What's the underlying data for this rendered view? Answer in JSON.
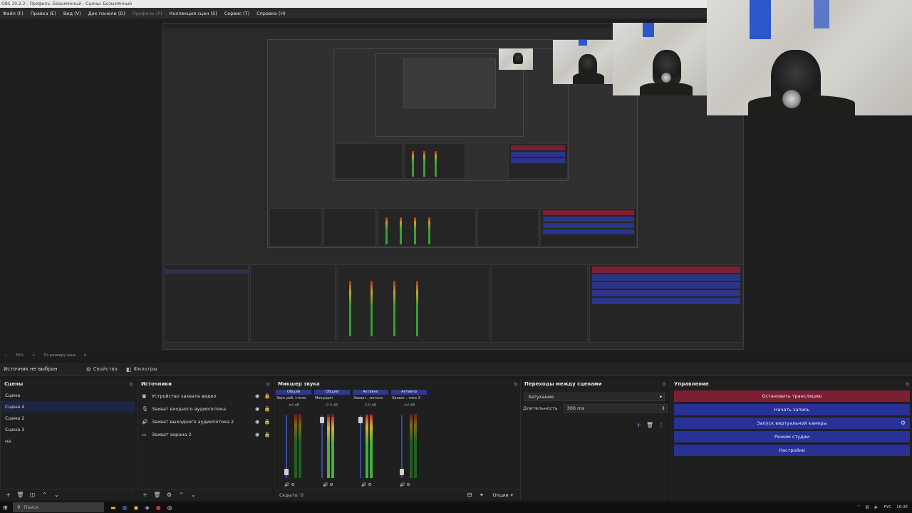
{
  "window": {
    "title": "OBS 30.2.2 - Профиль: Безымянный - Сцены: Безымянный"
  },
  "menu": [
    {
      "label": "Файл (F)",
      "enabled": true
    },
    {
      "label": "Правка (E)",
      "enabled": true
    },
    {
      "label": "Вид (V)",
      "enabled": true
    },
    {
      "label": "Док-панели (D)",
      "enabled": true
    },
    {
      "label": "Профиль (P)",
      "enabled": false
    },
    {
      "label": "Коллекция сцен (S)",
      "enabled": true
    },
    {
      "label": "Сервис (T)",
      "enabled": true
    },
    {
      "label": "Справка (H)",
      "enabled": true
    }
  ],
  "statusbar": {
    "zoom": "50%",
    "fit": "По размеру окна"
  },
  "context": {
    "no_source": "Источник не выбран",
    "properties": "Свойства",
    "filters": "Фильтры"
  },
  "scenes": {
    "title": "Сцены",
    "items": [
      "Сцена",
      "Сцена 4",
      "Сцена 2",
      "Сцена 3",
      "на"
    ],
    "selected_index": 1
  },
  "sources": {
    "title": "Источники",
    "items": [
      {
        "name": "Устройство захвата видео",
        "icon": "camera-icon"
      },
      {
        "name": "Захват входного аудиопотока",
        "icon": "microphone-icon"
      },
      {
        "name": "Захват выходного аудиопотока 2",
        "icon": "speaker-icon"
      },
      {
        "name": "Захват экрана 2",
        "icon": "monitor-icon"
      }
    ]
  },
  "mixer": {
    "title": "Микшер звука",
    "channels": [
      {
        "tab": "Общий",
        "name": "Звук раб. стола",
        "db": "-inf dB",
        "level": 0.0,
        "fader": 0.05
      },
      {
        "tab": "Общий",
        "name": "Микр/доп",
        "db": "0.0 dB",
        "level": 0.96,
        "fader": 0.96
      },
      {
        "tab": "Активно",
        "name": "Захват...потока",
        "db": "0.0 dB",
        "level": 0.98,
        "fader": 0.96
      },
      {
        "tab": "Активно",
        "name": "Захват...тока 2",
        "db": "-inf dB",
        "level": 0.0,
        "fader": 0.05
      }
    ],
    "scale": [
      "0",
      "-6",
      "-12",
      "-18",
      "-24",
      "-30",
      "-36",
      "-42",
      "-48",
      "-54",
      "-60"
    ],
    "hidden": "Скрыто: 0",
    "options": "Опции"
  },
  "transitions": {
    "title": "Переходы между сценами",
    "type": "Затухание",
    "duration_label": "Длительность",
    "duration_value": "300 ms"
  },
  "controls": {
    "title": "Управление",
    "stop_stream": "Остановить трансляцию",
    "start_record": "Начать запись",
    "virtual_cam": "Запуск виртуальной камеры",
    "studio_mode": "Режим студии",
    "settings": "Настройки"
  },
  "taskbar": {
    "search": "Поиск",
    "lang": "РУС",
    "time": "16:36"
  },
  "colors": {
    "accent": "#283296",
    "stop": "#7d1f33",
    "selected": "#1e2540"
  }
}
